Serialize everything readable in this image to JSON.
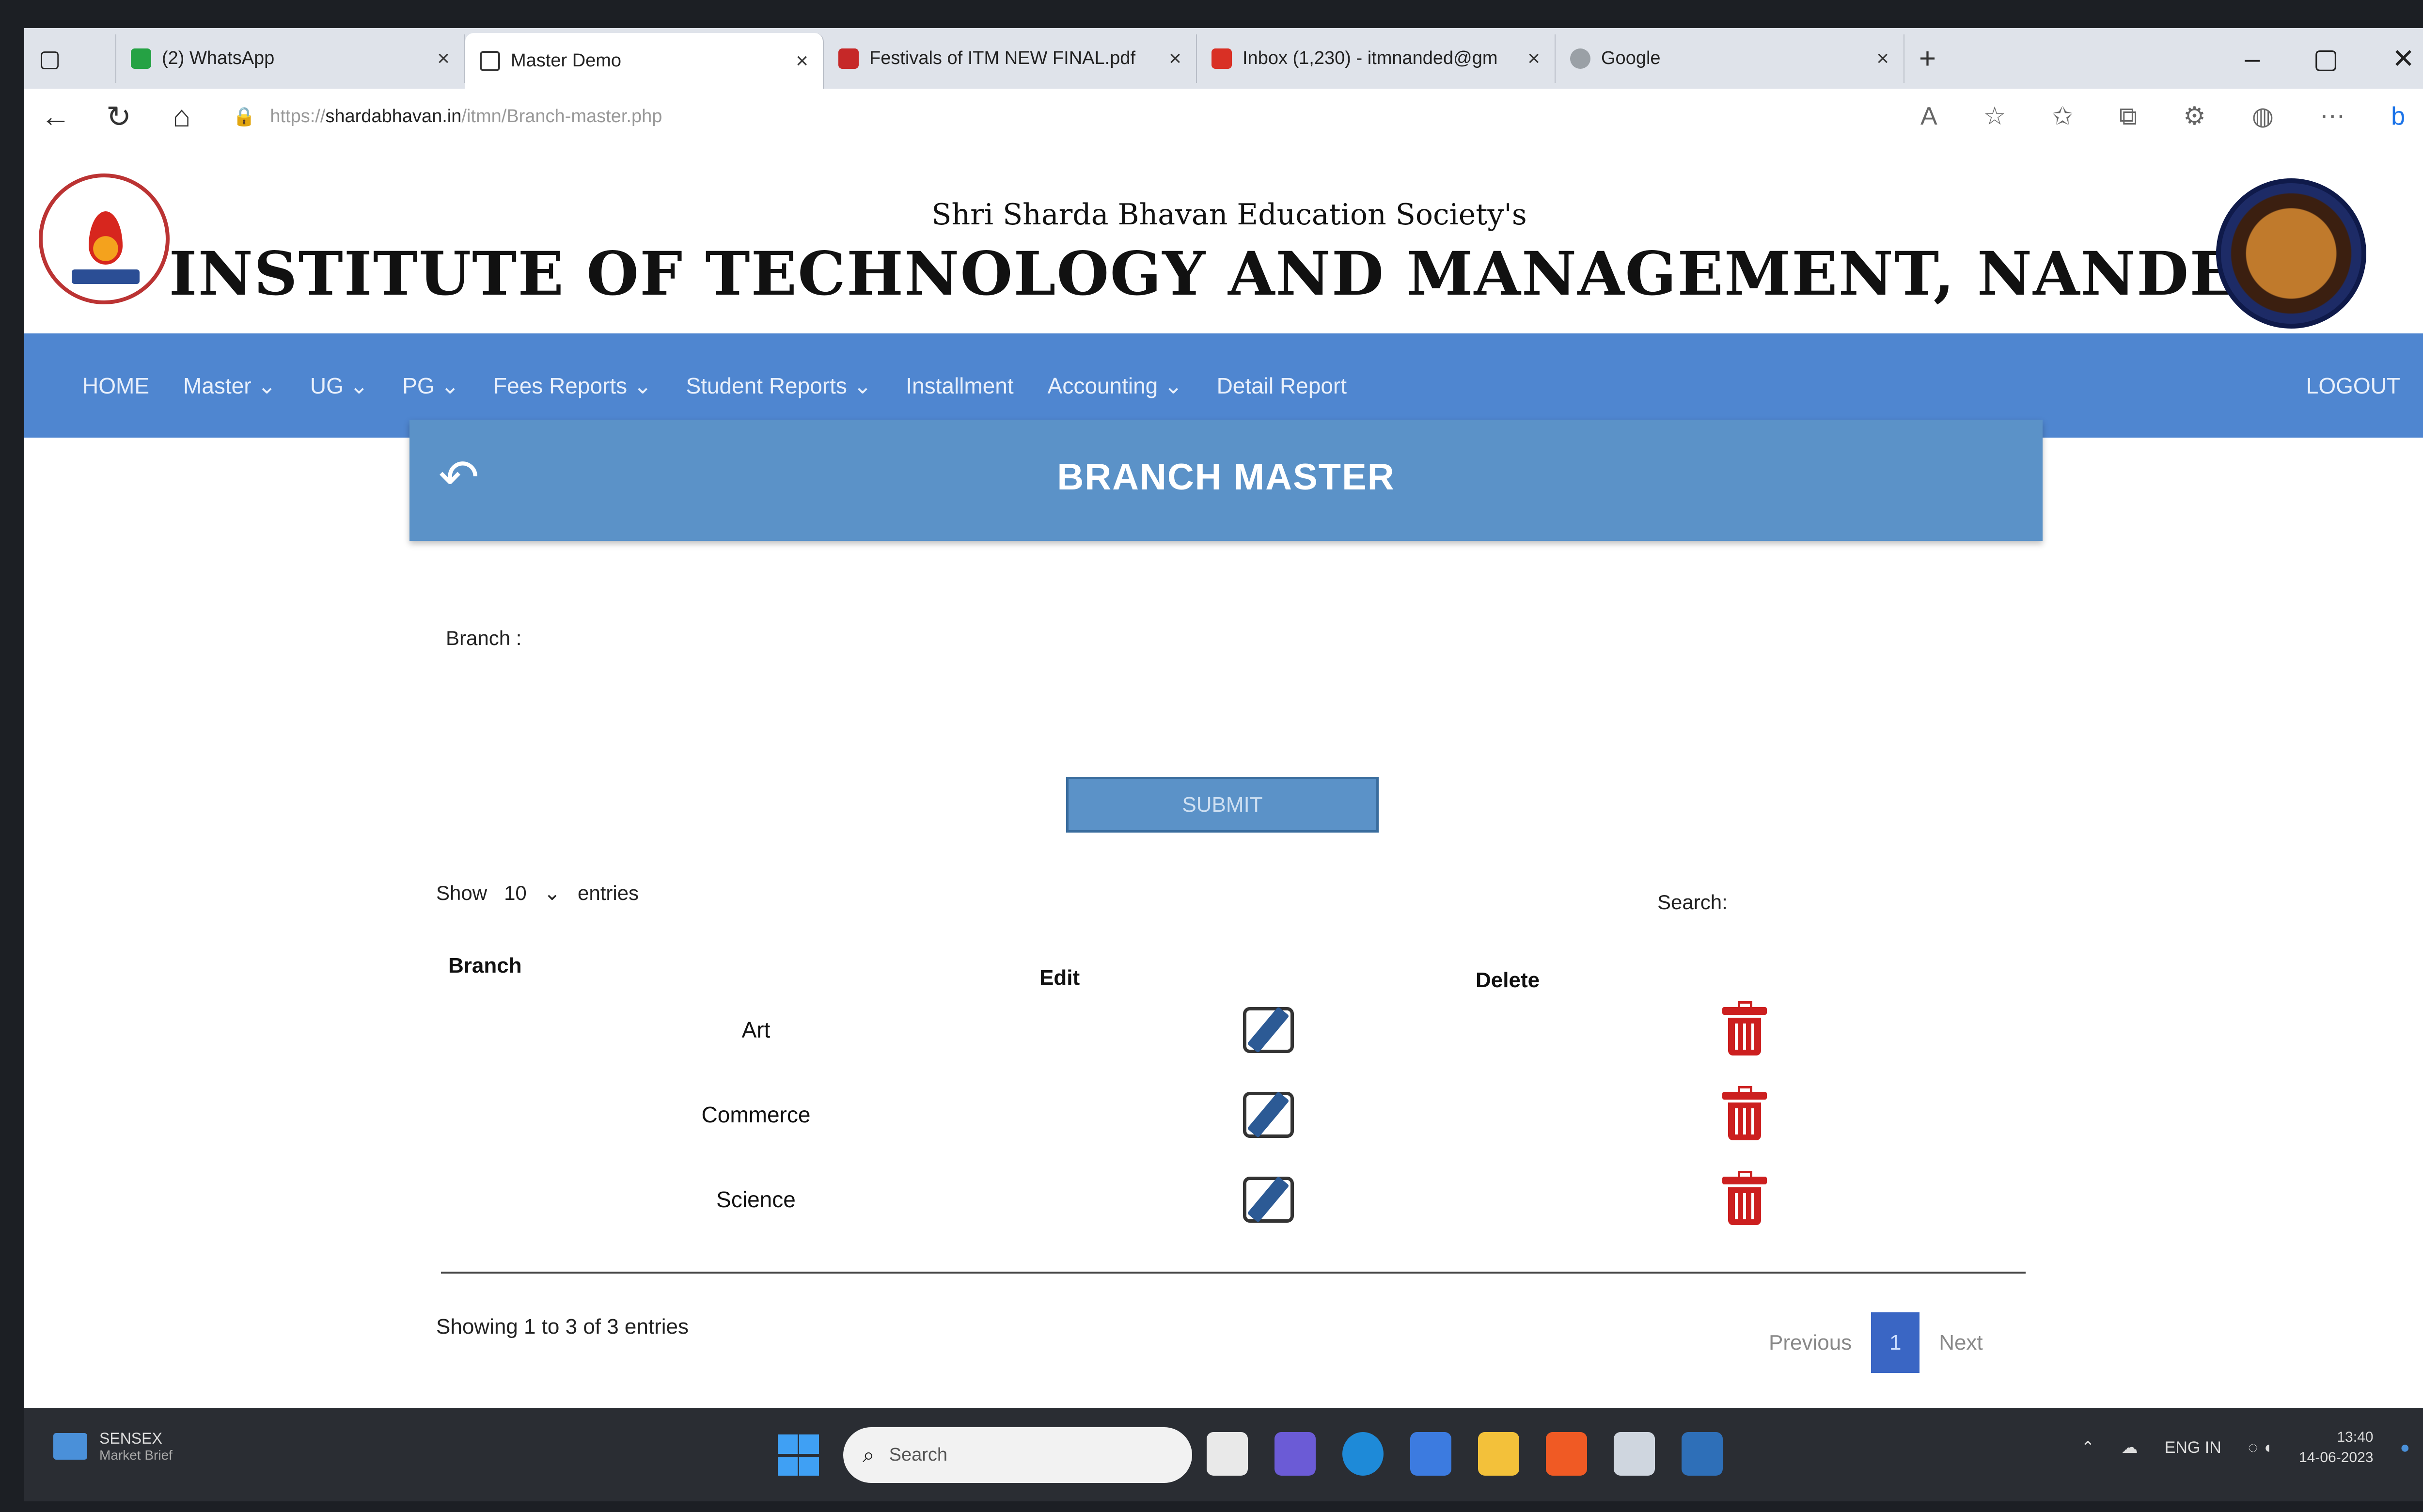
{
  "browser": {
    "tabs": [
      {
        "label": "(2) WhatsApp",
        "active": false,
        "fav": "#25a244"
      },
      {
        "label": "Master Demo",
        "active": true,
        "fav": "#ffffff"
      },
      {
        "label": "Festivals of ITM NEW FINAL.pdf",
        "active": false,
        "fav": "#c62828"
      },
      {
        "label": "Inbox (1,230) - itmnanded@gm",
        "active": false,
        "fav": "#d93025"
      },
      {
        "label": "Google",
        "active": false,
        "fav": "#9aa0a6"
      }
    ],
    "url_prefix": "https://",
    "url_host": "shardabhavan.in",
    "url_path": "/itmn/Branch-master.php"
  },
  "header": {
    "society": "Shri Sharda Bhavan Education Society's",
    "title": "INSTITUTE OF TECHNOLOGY AND MANAGEMENT, NANDED"
  },
  "nav": {
    "items": [
      "HOME",
      "Master ⌄",
      "UG ⌄",
      "PG ⌄",
      "Fees Reports ⌄",
      "Student Reports ⌄",
      "Installment",
      "Accounting ⌄",
      "Detail Report"
    ],
    "logout": "LOGOUT"
  },
  "panel": {
    "title": "BRANCH MASTER",
    "branch_label": "Branch :",
    "submit": "SUBMIT"
  },
  "table": {
    "show_label": "Show",
    "page_size": "10",
    "entries_label": "entries",
    "search_label": "Search:",
    "headers": {
      "branch": "Branch",
      "edit": "Edit",
      "delete": "Delete"
    },
    "rows": [
      {
        "branch": "Art"
      },
      {
        "branch": "Commerce"
      },
      {
        "branch": "Science"
      }
    ],
    "info": "Showing 1 to 3 of 3 entries",
    "previous": "Previous",
    "page": "1",
    "next": "Next"
  },
  "taskbar": {
    "weather_title": "SENSEX",
    "weather_sub": "Market Brief",
    "search_placeholder": "Search",
    "lang": "ENG IN",
    "time": "13:40",
    "date": "14-06-2023"
  },
  "colors": {
    "navbar": "#4f86d0",
    "panel": "#5b92c8",
    "delete": "#cc1f1f",
    "pager_active": "#3a66c4"
  }
}
